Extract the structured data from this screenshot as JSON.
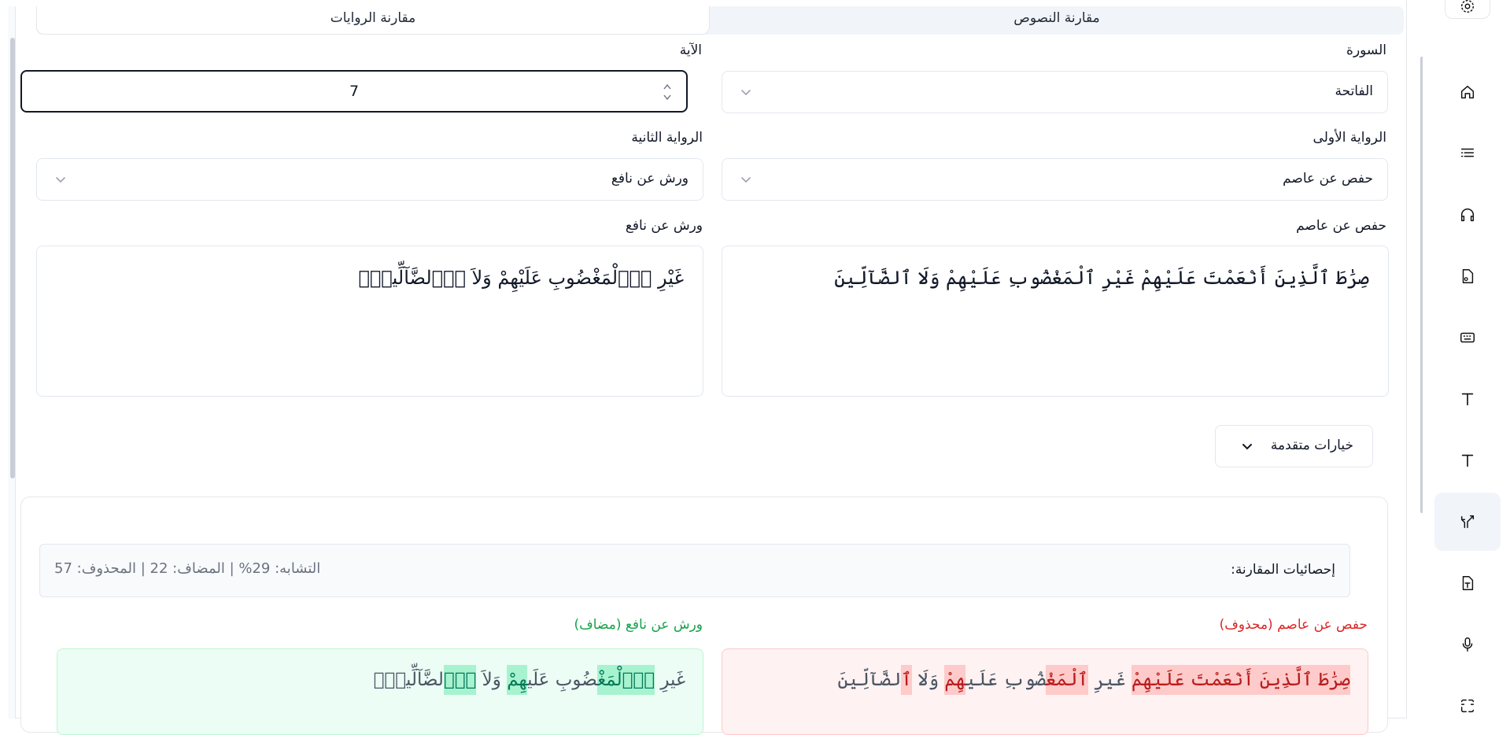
{
  "tabs": {
    "compare_texts": "مقارنة النصوص",
    "compare_narrations": "مقارنة الروايات"
  },
  "form": {
    "surah_label": "السورة",
    "surah_value": "الفاتحة",
    "ayah_label": "الآية",
    "ayah_value": "7",
    "first_narration_label": "الرواية الأولى",
    "first_narration_value": "حفص عن عاصم",
    "second_narration_label": "الرواية الثانية",
    "second_narration_value": "ورش عن نافع"
  },
  "texts": {
    "first_title": "حفص عن عاصم",
    "first_text": "صِرَٰطَ ٱلَّذِينَ أَنْعَمْتَ عَلَيْهِمْ غَيْرِ ٱلْمَغْضُوبِ عَلَيْهِمْ وَلَا ٱلضَّآلِّينَ",
    "second_title": "ورش عن نافع",
    "second_text": "غَيْرِ اِ۬لْمَغْضُوبِ عَلَيْهِمْ وَلاَ اَ۬لضَّآلِّينَۖ"
  },
  "advanced": {
    "label": "خيارات متقدمة"
  },
  "stats": {
    "title": "إحصائيات المقارنة:",
    "summary": "التشابه: 29% | المضاف: 22 | المحذوف: 57"
  },
  "diff": {
    "first_label": "حفص عن عاصم (محذوف)",
    "second_label": "ورش عن نافع (مضاف)",
    "first_segments": [
      {
        "text": "صِرَٰطَ ٱلَّذِينَ أَنْعَمْتَ عَلَيْهِمْ",
        "type": "del"
      },
      {
        "text": " غَيرِ ",
        "type": "same"
      },
      {
        "text": "ٱلْمَغْ",
        "type": "del"
      },
      {
        "text": "ضُوبِ عَلَي",
        "type": "same"
      },
      {
        "text": "هِمْ",
        "type": "del"
      },
      {
        "text": " وَلَا ",
        "type": "same"
      },
      {
        "text": "ٱ",
        "type": "del"
      },
      {
        "text": "لضَّآلِّينَ",
        "type": "same"
      }
    ],
    "second_segments": [
      {
        "text": "غَيرِ ",
        "type": "same"
      },
      {
        "text": "اِ۬لْمَغْ",
        "type": "add"
      },
      {
        "text": "ضُوبِ عَلَي",
        "type": "same"
      },
      {
        "text": "هِمْ",
        "type": "add"
      },
      {
        "text": " وَلاَ ",
        "type": "same"
      },
      {
        "text": "اَ۬",
        "type": "add"
      },
      {
        "text": "لضَّآلِّينَۖ",
        "type": "same"
      }
    ]
  },
  "colors": {
    "deleted": "#dc2626",
    "added": "#16a34a",
    "deleted_bg": "#fef2f2",
    "added_bg": "#ecfdf5"
  },
  "sidebar_icons": [
    "gear-icon",
    "home-icon",
    "list-icon",
    "headphones-icon",
    "file-audio-icon",
    "keyboard-icon",
    "text-icon",
    "text-alt-icon",
    "compare-icon",
    "file-text-icon",
    "microphone-icon",
    "speech-icon"
  ]
}
